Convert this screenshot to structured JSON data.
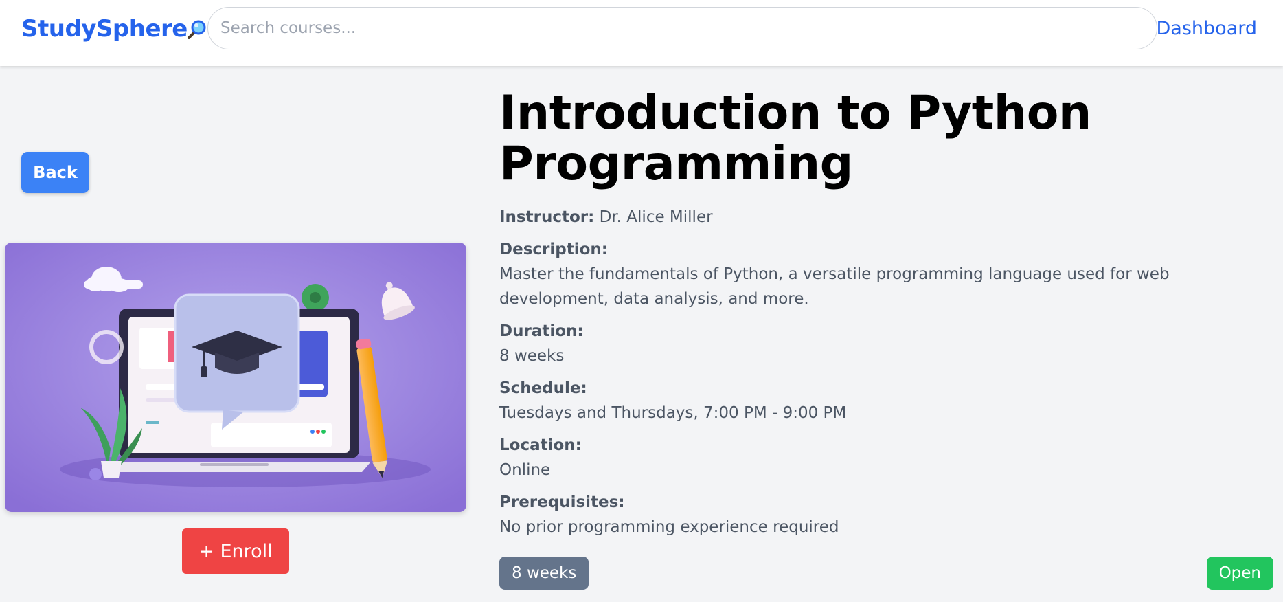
{
  "navbar": {
    "brand": "StudySphere",
    "search_placeholder": "Search courses...",
    "search_icon": "magnifier-icon",
    "dashboard_link": "Dashboard"
  },
  "actions": {
    "back_label": "Back",
    "enroll_label": "+ Enroll"
  },
  "course": {
    "title": "Introduction to Python Programming",
    "instructor_label": "Instructor:",
    "instructor": "Dr. Alice Miller",
    "description_label": "Description:",
    "description": "Master the fundamentals of Python, a versatile programming language used for web development, data analysis, and more.",
    "duration_label": "Duration:",
    "duration": "8 weeks",
    "schedule_label": "Schedule:",
    "schedule": "Tuesdays and Thursdays, 7:00 PM - 9:00 PM",
    "location_label": "Location:",
    "location": "Online",
    "prerequisites_label": "Prerequisites:",
    "prerequisites": "No prior programming experience required"
  },
  "badges": {
    "duration": "8 weeks",
    "status": "Open"
  },
  "colors": {
    "brand": "#2563eb",
    "back_button": "#3b82f6",
    "enroll_button": "#ef4444",
    "duration_badge": "#64748b",
    "status_badge": "#22c55e",
    "illustration_bg": "#8b6fd6"
  },
  "image": {
    "icon": "graduation-cap-icon"
  }
}
